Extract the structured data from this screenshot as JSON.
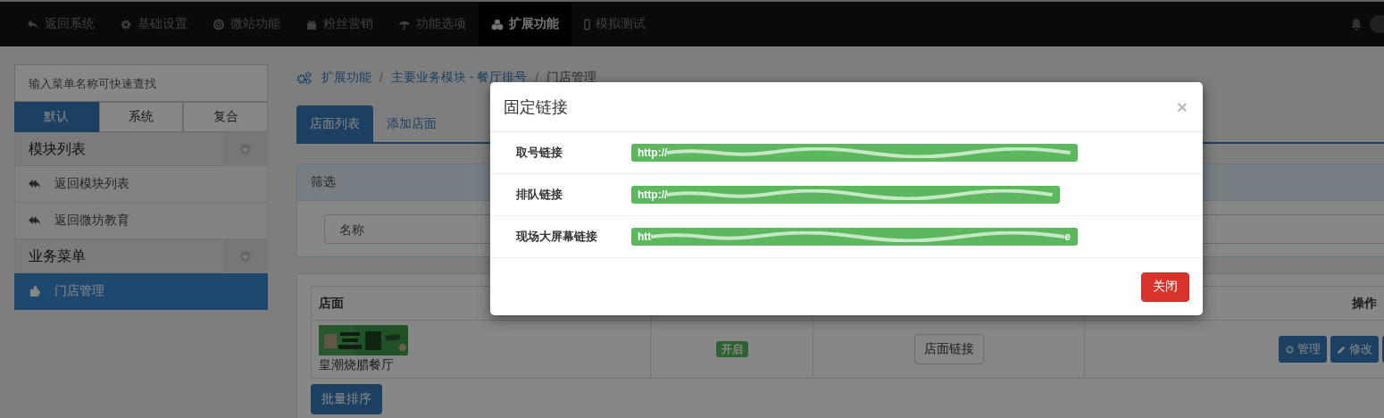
{
  "navbar": {
    "items": [
      {
        "label": "返回系统",
        "selected": false
      },
      {
        "label": "基础设置",
        "selected": false
      },
      {
        "label": "微站功能",
        "selected": false
      },
      {
        "label": "粉丝营销",
        "selected": false
      },
      {
        "label": "功能选项",
        "selected": false
      },
      {
        "label": "扩展功能",
        "selected": true
      },
      {
        "label": "模拟测试",
        "selected": false
      }
    ]
  },
  "sidebar": {
    "search": {
      "placeholder": "输入菜单名称可快速查找"
    },
    "tabs": [
      {
        "label": "默认",
        "selected": true
      },
      {
        "label": "系统",
        "selected": false
      },
      {
        "label": "复合",
        "selected": false
      }
    ],
    "groups": [
      {
        "title": "模块列表",
        "items": [
          {
            "label": "返回模块列表",
            "selected": false
          },
          {
            "label": "返回微坊教育",
            "selected": false
          }
        ]
      },
      {
        "title": "业务菜单",
        "items": [
          {
            "label": "门店管理",
            "selected": true
          }
        ]
      }
    ]
  },
  "breadcrumb": {
    "separator": "/",
    "items": [
      "扩展功能",
      "主要业务模块 - 餐厅排号",
      "门店管理"
    ]
  },
  "tabs": [
    {
      "label": "店面列表",
      "selected": true
    },
    {
      "label": "添加店面",
      "selected": false
    }
  ],
  "filter": {
    "title": "筛选",
    "name_field": {
      "placeholder": "名称"
    }
  },
  "table": {
    "column_1": "店面",
    "column_4": "操作",
    "rows": [
      {
        "name": "皇潮烧腊餐厅",
        "status": "开启",
        "link_button": "店面链接",
        "actions": [
          "管理",
          "修改"
        ]
      }
    ]
  },
  "batch_button": "批量排序",
  "modal": {
    "title": "固定链接",
    "close": "×",
    "links": [
      {
        "label": "取号链接",
        "url": "http://"
      },
      {
        "label": "排队链接",
        "url": "http://"
      },
      {
        "label": "现场大屏幕链接",
        "url": "htt",
        "url_end": "e"
      }
    ],
    "button": "关闭"
  }
}
